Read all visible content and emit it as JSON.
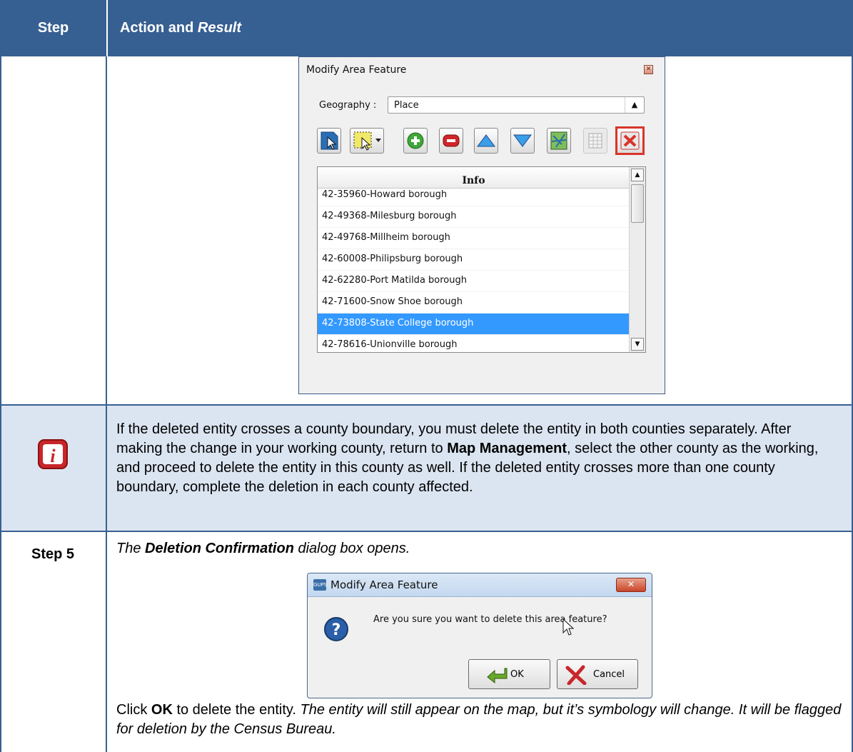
{
  "header": {
    "step_label": "Step",
    "action_label": "Action and ",
    "result_label": "Result"
  },
  "panel": {
    "title": "Modify Area Feature",
    "geography_label": "Geography :",
    "geography_value": "Place",
    "list_header": "Info",
    "items": [
      "42-35960-Howard borough",
      "42-49368-Milesburg borough",
      "42-49768-Millheim borough",
      "42-60008-Philipsburg borough",
      "42-62280-Port Matilda borough",
      "42-71600-Snow Shoe borough",
      "42-73808-State College borough",
      "42-78616-Unionville borough"
    ],
    "selected_item": "42-73808-State College borough",
    "toolbar_icons": [
      "select-feature-icon",
      "select-rectangle-icon",
      "add-icon",
      "remove-icon",
      "move-up-icon",
      "move-down-icon",
      "map-icon",
      "table-icon",
      "delete-icon"
    ]
  },
  "info_note": {
    "t1": "If the deleted entity crosses a county boundary, you must delete the entity in both counties separately. After making the change in your working county, return to ",
    "b1": "Map Management",
    "t2": ", select the other county as the working, and proceed to delete the entity in this county as well. If the deleted entity crosses more than one county boundary, complete the deletion in each county affected."
  },
  "step5": {
    "label": "Step 5",
    "desc_pre": "The ",
    "desc_bold": "Deletion Confirmation",
    "desc_post": " dialog box opens.",
    "click_pre": "Click ",
    "click_bold": "OK",
    "click_mid": " to delete the entity. ",
    "click_italic": "The entity will still appear on the map, but it’s symbology will change. It will be flagged for deletion by the Census Bureau."
  },
  "dialog": {
    "app_icon_text": "GUPS",
    "title": "Modify Area Feature",
    "message": "Are you sure you want to delete this area feature?",
    "ok_label": "OK",
    "cancel_label": "Cancel"
  },
  "colors": {
    "header_bg": "#376092",
    "info_row_bg": "#dbe5f1",
    "selection": "#3399ff",
    "delete_highlight": "#d9342b"
  }
}
